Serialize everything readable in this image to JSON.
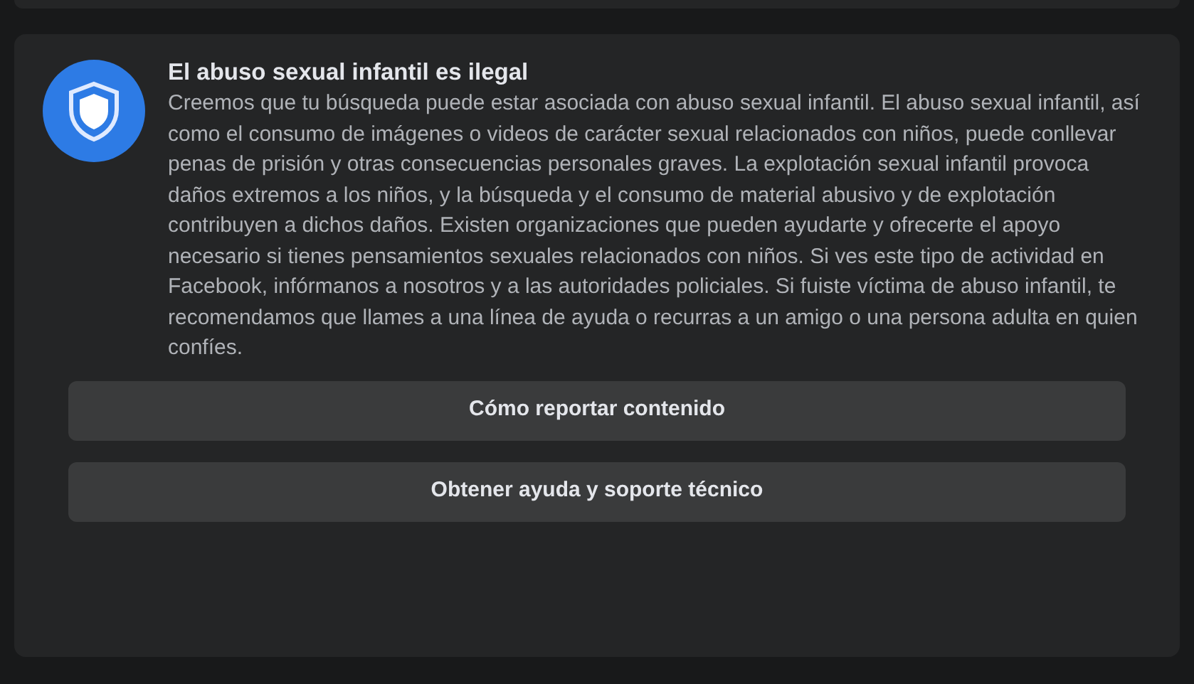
{
  "notice": {
    "title": "El abuso sexual infantil es ilegal",
    "body": "Creemos que tu búsqueda puede estar asociada con abuso sexual infantil. El abuso sexual infantil, así como el consumo de imágenes o videos de carácter sexual relacionados con niños, puede conllevar penas de prisión y otras consecuencias personales graves. La explotación sexual infantil provoca daños extremos a los niños, y la búsqueda y el consumo de material abusivo y de explotación contribuyen a dichos daños. Existen organizaciones que pueden ayudarte y ofrecerte el apoyo necesario si tienes pensamientos sexuales relacionados con niños. Si ves este tipo de actividad en Facebook, infórmanos a nosotros y a las autoridades policiales. Si fuiste víctima de abuso infantil, te recomendamos que llames a una línea de ayuda o recurras a un amigo o una persona adulta en quien confíes."
  },
  "buttons": [
    "Cómo reportar contenido",
    "Obtener ayuda y soporte técnico"
  ]
}
